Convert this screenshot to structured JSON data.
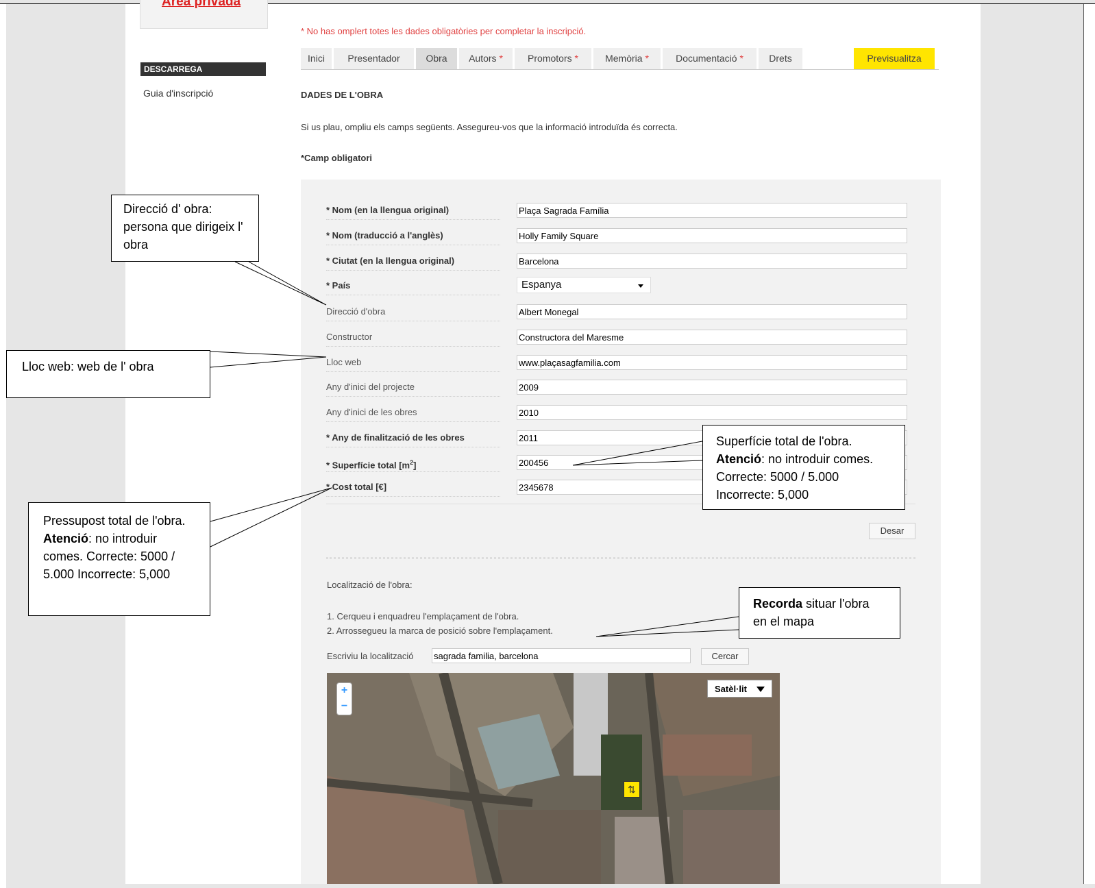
{
  "sidebar": {
    "private_area": "Àrea privada",
    "download_header": "DESCARREGA",
    "guide_link": "Guia d'inscripció"
  },
  "error_message": "* No has omplert totes les dades obligatòries per completar la inscripció.",
  "tabs": [
    {
      "label": "Inici",
      "required": ""
    },
    {
      "label": "Presentador",
      "required": ""
    },
    {
      "label": "Obra",
      "required": ""
    },
    {
      "label": "Autors",
      "required": "*"
    },
    {
      "label": "Promotors",
      "required": "*"
    },
    {
      "label": "Memòria",
      "required": "*"
    },
    {
      "label": "Documentació",
      "required": "*"
    },
    {
      "label": "Drets",
      "required": ""
    }
  ],
  "active_tab": "Obra",
  "preview_button": "Previsualitza",
  "section": {
    "title": "DADES DE L'OBRA",
    "intro": "Si us plau, ompliu els camps següents. Assegureu-vos que la informació introduïda és correcta.",
    "mandatory_note": "*Camp obligatori"
  },
  "form": {
    "nom_original": {
      "label": "* Nom (en la llengua original)",
      "value": "Plaça Sagrada Família"
    },
    "nom_angles": {
      "label": "* Nom (traducció a l'anglès)",
      "value": "Holly Family Square"
    },
    "ciutat": {
      "label": "* Ciutat (en la llengua original)",
      "value": "Barcelona"
    },
    "pais": {
      "label": "* País",
      "value": "Espanya"
    },
    "direccio": {
      "label": "Direcció d'obra",
      "value": "Albert Monegal"
    },
    "constructor": {
      "label": "Constructor",
      "value": "Constructora del Maresme"
    },
    "lloc_web": {
      "label": "Lloc web",
      "value": "www.plaçasagfamilia.com"
    },
    "any_projecte": {
      "label": "Any d'inici del projecte",
      "value": "2009"
    },
    "any_obres": {
      "label": "Any d'inici de les obres",
      "value": "2010"
    },
    "any_final": {
      "label": "* Any de finalització de les obres",
      "value": "2011"
    },
    "superficie": {
      "label": "* Superfície total [m",
      "sup": "2",
      "label_end": "]",
      "value": "200456"
    },
    "cost": {
      "label": "* Cost total [€]",
      "value": "2345678"
    },
    "save_button": "Desar"
  },
  "location": {
    "title": "Localització de l'obra:",
    "step1": "1. Cerqueu i enquadreu l'emplaçament de l'obra.",
    "step2": "2. Arrossegueu la marca de posició sobre l'emplaçament.",
    "search_label": "Escriviu la localització",
    "search_value": "sagrada familia, barcelona",
    "search_button": "Cercar",
    "map_type": "Satèl·lit",
    "zoom_in": "+",
    "zoom_out": "−"
  },
  "callouts": {
    "direccio": "Direcció d' obra: persona que dirigeix l' obra",
    "lloc_web": "Lloc web: web de l' obra",
    "superficie_1": "Superfície total de l'obra.",
    "superficie_bold": "Atenció",
    "superficie_2": ": no introduir comes. Correcte: 5000 / 5.000 Incorrecte: 5,000",
    "pressupost_1": "Pressupost total de l'obra.",
    "pressupost_bold": "Atenció",
    "pressupost_2": ": no introduir comes. Correcte: 5000 / 5.000 Incorrecte: 5,000",
    "recorda_bold": "Recorda",
    "recorda_2": " situar l'obra en el mapa"
  }
}
